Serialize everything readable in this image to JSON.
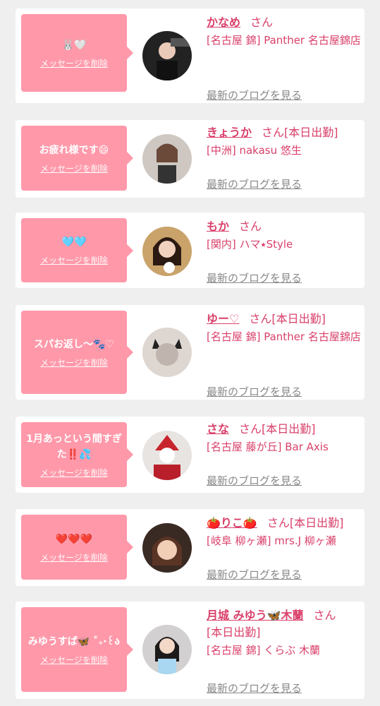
{
  "delete_label": "メッセージを削除",
  "blog_label": "最新のブログを見る",
  "san_label": "さん",
  "colors": {
    "bubble": "#ff99aa",
    "accent": "#d9406a",
    "link_gray": "#888888"
  },
  "items": [
    {
      "message": "🐰🤍",
      "name": "かなめ",
      "status": "",
      "store": "[名古屋 錦] Panther 名古屋錦店"
    },
    {
      "message": "お疲れ様です😄",
      "name": "きょうか",
      "status": "[本日出勤]",
      "store": "[中洲] nakasu 悠生"
    },
    {
      "message": "🩵🩵",
      "name": "もか",
      "status": "",
      "store": "[関内] ハマ⭑Style"
    },
    {
      "message": "スパお返し〜🐾♡",
      "name": "ゆー♡",
      "status": "[本日出勤]",
      "store": "[名古屋 錦] Panther 名古屋錦店"
    },
    {
      "message": "1月あっという間すぎた‼️💦",
      "name": "さな",
      "status": "[本日出勤]",
      "store": "[名古屋 藤が丘] Bar Axis"
    },
    {
      "message": "❤️❤️❤️",
      "name": "🍅りこ🍅",
      "status": "[本日出勤]",
      "store": "[岐阜 柳ヶ瀬] mrs.J 柳ヶ瀬"
    },
    {
      "message": "みゆうすば🦋 ˚₊‧꒰ა",
      "name": "月城 みゆう🦋木蘭",
      "status": "[本日出勤]",
      "store": "[名古屋 錦] くらぶ 木蘭"
    }
  ]
}
